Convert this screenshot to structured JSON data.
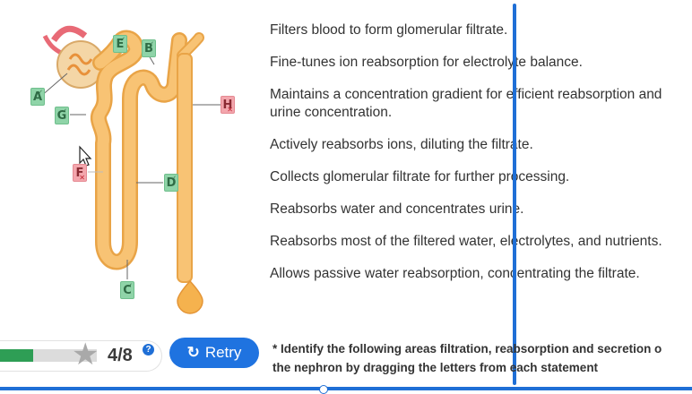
{
  "diagram": {
    "labels": [
      {
        "id": "E",
        "letter": "E",
        "status": "correct",
        "mark": "✓"
      },
      {
        "id": "B",
        "letter": "B",
        "status": "correct",
        "mark": "✓"
      },
      {
        "id": "A",
        "letter": "A",
        "status": "correct",
        "mark": "✓"
      },
      {
        "id": "G",
        "letter": "G",
        "status": "correct",
        "mark": "✓"
      },
      {
        "id": "H",
        "letter": "H",
        "status": "incorrect",
        "mark": "✕"
      },
      {
        "id": "F",
        "letter": "F",
        "status": "incorrect",
        "mark": "✕"
      },
      {
        "id": "D",
        "letter": "D",
        "status": "correct",
        "mark": "✓"
      },
      {
        "id": "C",
        "letter": "C",
        "status": "correct",
        "mark": "✓"
      }
    ],
    "colors": {
      "tubule": "#f8c374",
      "tubule_edge": "#e9a447",
      "vessel": "#e86a76",
      "correct": "#8fd4a8",
      "incorrect": "#f3a6ad"
    }
  },
  "statements": [
    "Filters blood to form glomerular filtrate.",
    "Fine-tunes ion reabsorption for electrolyte balance.",
    "Maintains a concentration gradient for efficient reabsorption and urine concentration.",
    "Actively reabsorbs ions, diluting the filtrate.",
    "Collects glomerular filtrate for further processing.",
    "Reabsorbs water and concentrates urine.",
    "Reabsorbs most of the filtered water, electrolytes, and nutrients.",
    "Allows passive water reabsorption, concentrating the filtrate."
  ],
  "progress": {
    "score_text": "4/8",
    "fraction": 0.25,
    "help_label": "?"
  },
  "retry": {
    "label": "Retry",
    "icon": "refresh-icon"
  },
  "instruction": {
    "line1": "* Identify the following areas filtration, reabsorption and secretion o",
    "line2": "the nephron by dragging the letters from each statement"
  }
}
